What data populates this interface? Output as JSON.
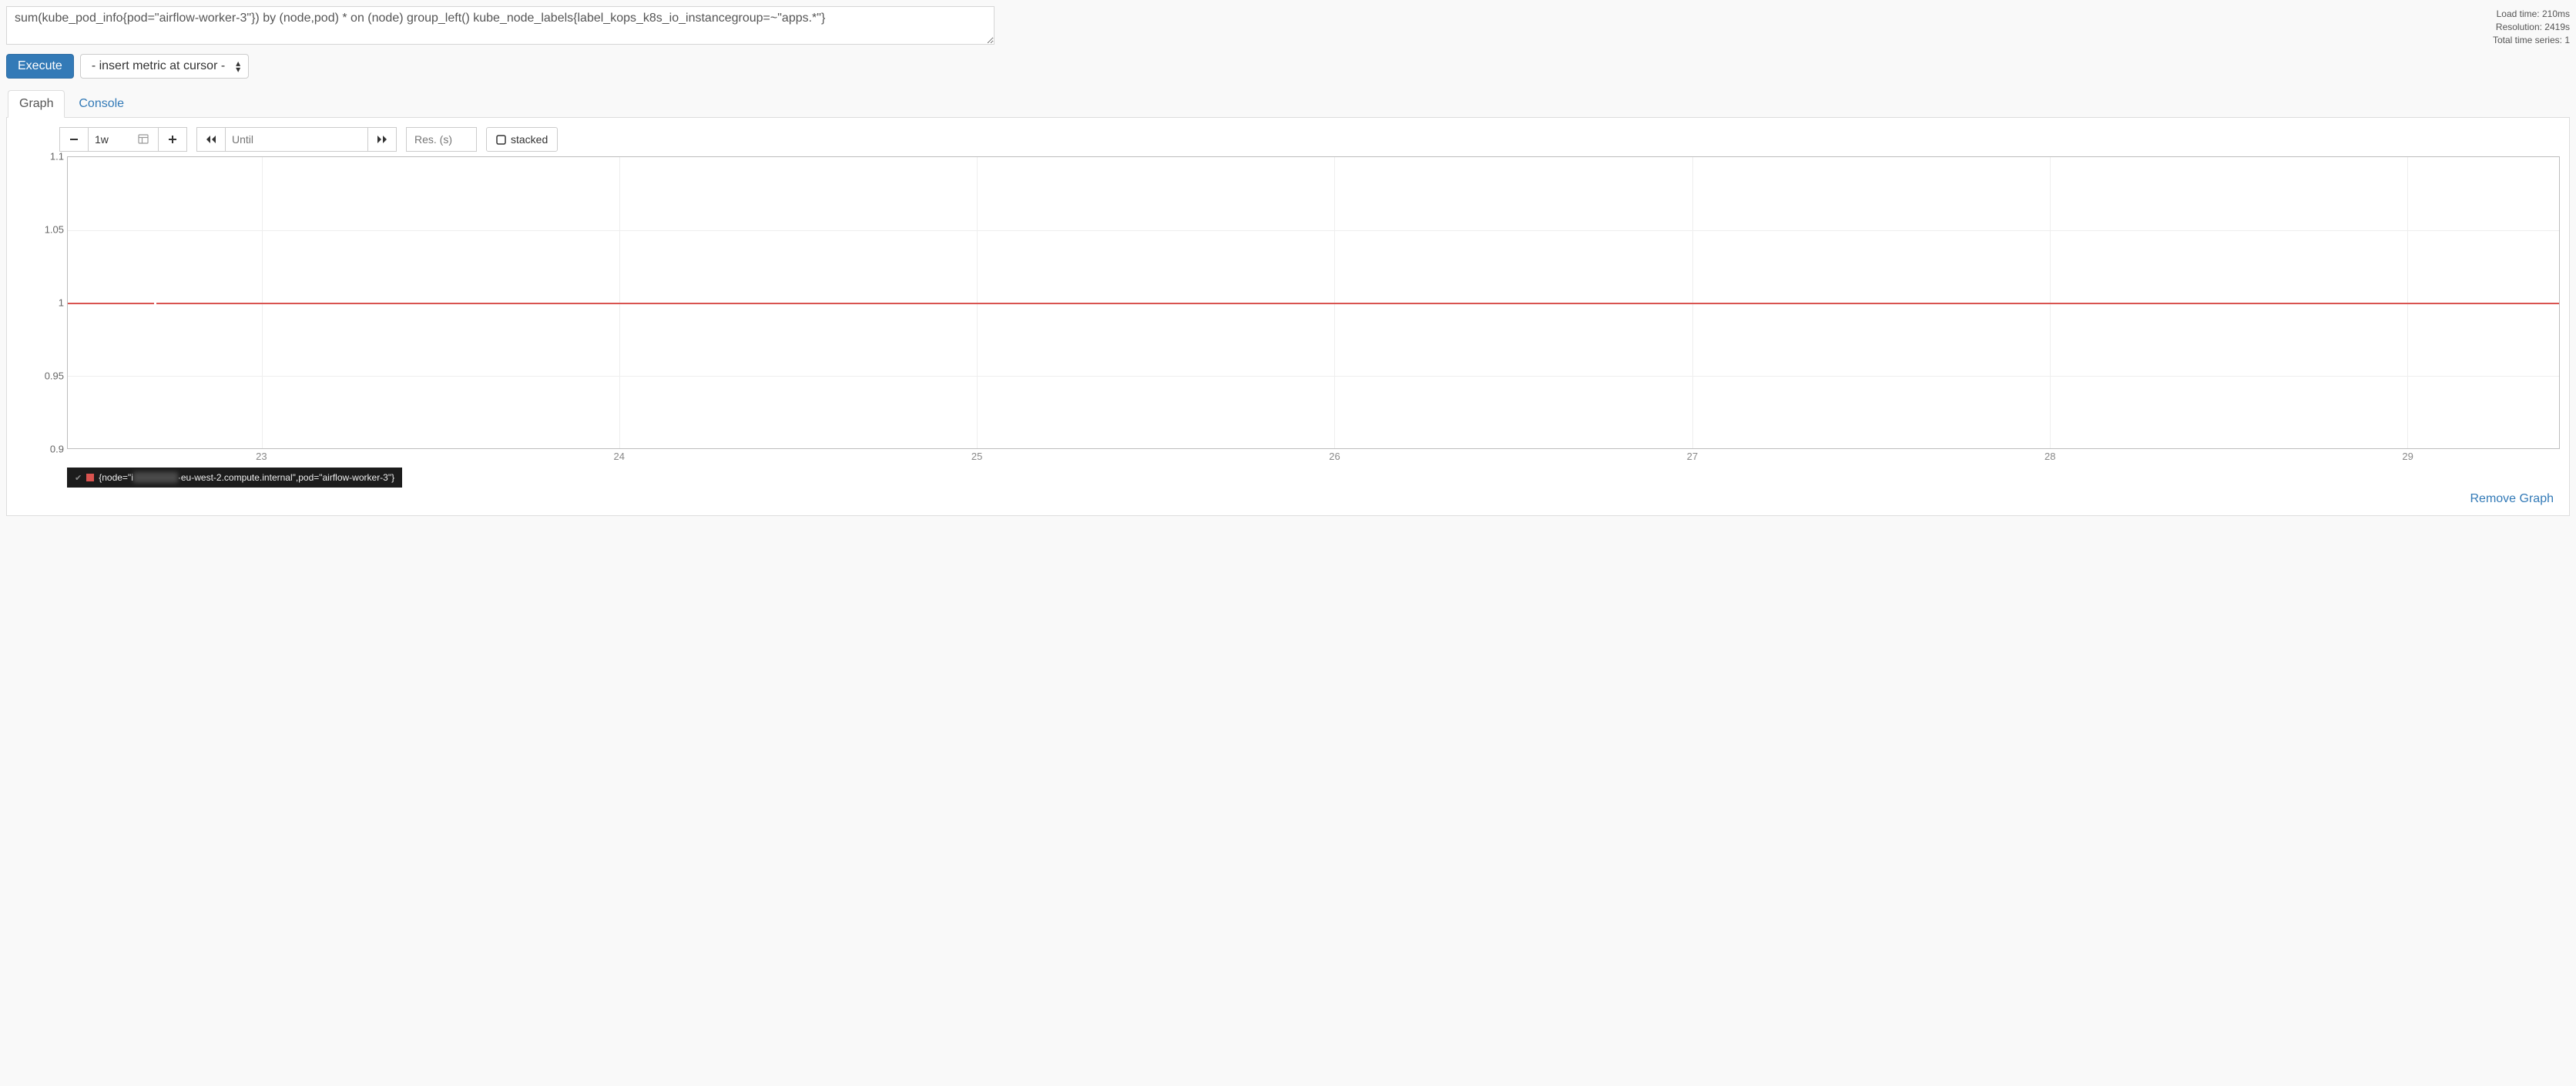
{
  "query": "sum(kube_pod_info{pod=\"airflow-worker-3\"}) by (node,pod) * on (node) group_left() kube_node_labels{label_kops_k8s_io_instancegroup=~\"apps.*\"}",
  "meta": {
    "load_time": "Load time: 210ms",
    "resolution": "Resolution: 2419s",
    "total_series": "Total time series: 1"
  },
  "buttons": {
    "execute": "Execute",
    "metric_select": "- insert metric at cursor -"
  },
  "tabs": {
    "graph": "Graph",
    "console": "Console"
  },
  "controls": {
    "range": "1w",
    "until_placeholder": "Until",
    "res_placeholder": "Res. (s)",
    "stacked": "stacked"
  },
  "chart_data": {
    "type": "line",
    "title": "",
    "xlabel": "",
    "ylabel": "",
    "ylim": [
      0.9,
      1.1
    ],
    "y_ticks": [
      0.9,
      0.95,
      1,
      1.05,
      1.1
    ],
    "x_ticks": [
      "23",
      "24",
      "25",
      "26",
      "27",
      "28",
      "29"
    ],
    "series": [
      {
        "name": "{node=\"ip-…·eu-west-2.compute.internal\",pod=\"airflow-worker-3\"}",
        "color": "#d9534f",
        "x": [
          "23",
          "24",
          "25",
          "26",
          "27",
          "28",
          "29"
        ],
        "values": [
          1,
          1,
          1,
          1,
          1,
          1,
          1
        ]
      }
    ]
  },
  "legend": {
    "prefix": "{node=\"i",
    "obscured": "p-10-0-0-0",
    "suffix": "·eu-west-2.compute.internal\",pod=\"airflow-worker-3\"}"
  },
  "footer": {
    "remove": "Remove Graph"
  }
}
